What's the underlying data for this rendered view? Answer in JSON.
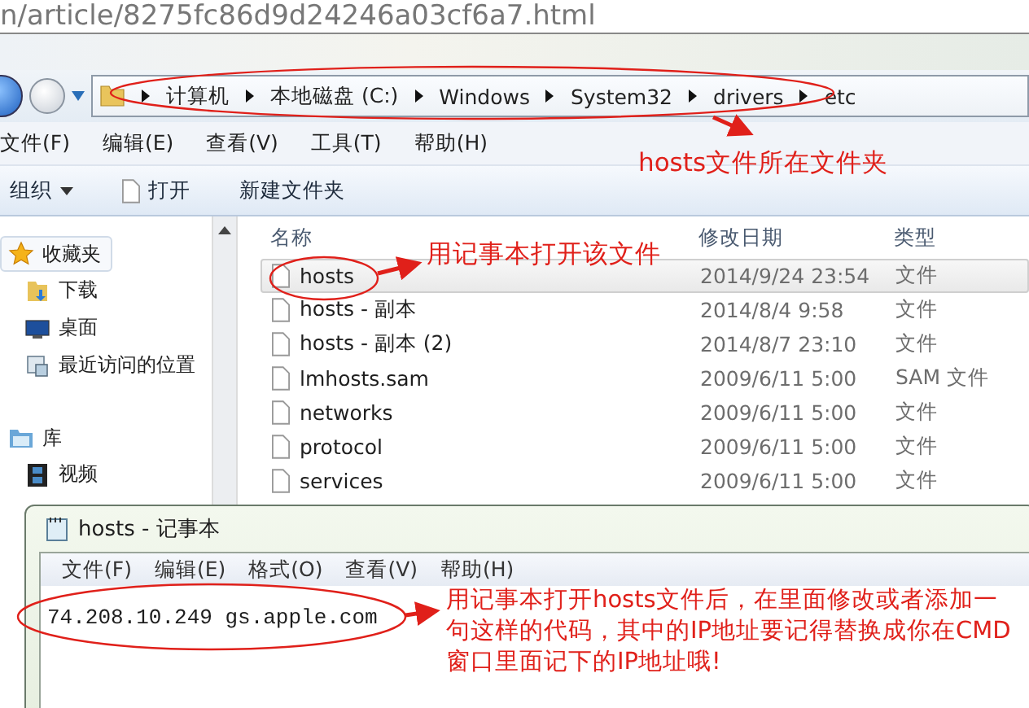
{
  "browser_url": "n/article/8275fc86d9d24246a03cf6a7.html",
  "explorer": {
    "breadcrumb": [
      "计算机",
      "本地磁盘 (C:)",
      "Windows",
      "System32",
      "drivers",
      "etc"
    ],
    "menu": [
      "文件(F)",
      "编辑(E)",
      "查看(V)",
      "工具(T)",
      "帮助(H)"
    ],
    "toolbar": [
      {
        "label": "组织",
        "kind": "dropdown"
      },
      {
        "label": "打开",
        "kind": "file"
      },
      {
        "label": "新建文件夹",
        "kind": "plain"
      }
    ],
    "nav": [
      {
        "label": "收藏夹",
        "kind": "star",
        "selected": true,
        "children": [
          {
            "label": "下载",
            "kind": "download",
            "selected": false
          },
          {
            "label": "桌面",
            "kind": "desktop",
            "selected": false
          },
          {
            "label": "最近访问的位置",
            "kind": "recent",
            "selected": false
          }
        ]
      },
      {
        "label": "库",
        "kind": "library",
        "selected": false,
        "children": [
          {
            "label": "视频",
            "kind": "video",
            "selected": false
          }
        ]
      }
    ],
    "columns": [
      "名称",
      "修改日期",
      "类型"
    ],
    "files": [
      {
        "name": "hosts",
        "date": "2014/9/24 23:54",
        "type": "文件",
        "selected": true
      },
      {
        "name": "hosts - 副本",
        "date": "2014/8/4 9:58",
        "type": "文件",
        "selected": false
      },
      {
        "name": "hosts - 副本 (2)",
        "date": "2014/8/7 23:10",
        "type": "文件",
        "selected": false
      },
      {
        "name": "lmhosts.sam",
        "date": "2009/6/11 5:00",
        "type": "SAM 文件",
        "selected": false
      },
      {
        "name": "networks",
        "date": "2009/6/11 5:00",
        "type": "文件",
        "selected": false
      },
      {
        "name": "protocol",
        "date": "2009/6/11 5:00",
        "type": "文件",
        "selected": false
      },
      {
        "name": "services",
        "date": "2009/6/11 5:00",
        "type": "文件",
        "selected": false
      }
    ]
  },
  "notepad": {
    "title": "hosts - 记事本",
    "menu": [
      "文件(F)",
      "编辑(E)",
      "格式(O)",
      "查看(V)",
      "帮助(H)"
    ],
    "content": "74.208.10.249 gs.apple.com"
  },
  "annotations": [
    "hosts文件所在文件夹",
    "用记事本打开该文件",
    "用记事本打开hosts文件后，在里面修改或者添加一句这样的代码，其中的IP地址要记得替换成你在CMD窗口里面记下的IP地址哦!"
  ]
}
